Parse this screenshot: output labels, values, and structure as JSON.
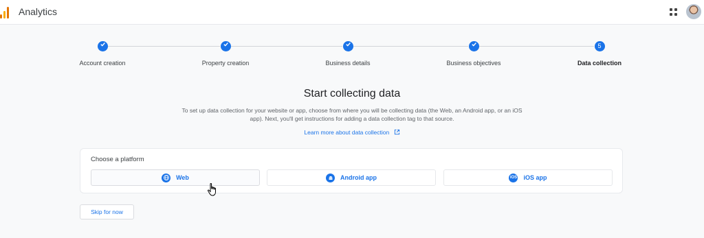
{
  "app": {
    "title": "Analytics"
  },
  "stepper": {
    "steps": [
      {
        "label": "Account creation",
        "state": "complete"
      },
      {
        "label": "Property creation",
        "state": "complete"
      },
      {
        "label": "Business details",
        "state": "complete"
      },
      {
        "label": "Business objectives",
        "state": "complete"
      },
      {
        "label": "Data collection",
        "state": "active",
        "number": "5"
      }
    ]
  },
  "main": {
    "heading": "Start collecting data",
    "description": "To set up data collection for your website or app, choose from where you will be collecting data (the Web, an Android app, or an iOS app). Next, you'll get instructions for adding a data collection tag to that source.",
    "learn_more": "Learn more about data collection"
  },
  "platforms": {
    "title": "Choose a platform",
    "options": [
      {
        "label": "Web",
        "icon": "globe-icon"
      },
      {
        "label": "Android app",
        "icon": "android-icon"
      },
      {
        "label": "iOS app",
        "icon": "ios-icon",
        "badge": "iOS"
      }
    ]
  },
  "actions": {
    "skip_label": "Skip for now"
  },
  "colors": {
    "accent": "#1a73e8",
    "brand_orange": "#e37400",
    "brand_yellow": "#f9ab00"
  }
}
